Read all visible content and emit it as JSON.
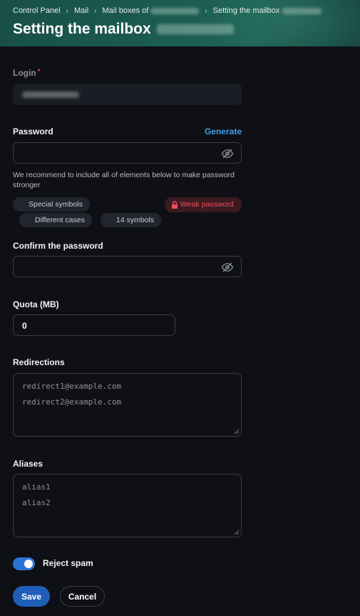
{
  "breadcrumb": {
    "items": [
      "Control Panel",
      "Mail",
      "Mail boxes of",
      "Setting the mailbox"
    ]
  },
  "page": {
    "title": "Setting the mailbox"
  },
  "form": {
    "login": {
      "label": "Login",
      "required_mark": "*"
    },
    "password": {
      "label": "Password",
      "generate_label": "Generate",
      "value": "",
      "hint": "We recommend to include all of elements below to make password stronger",
      "requirements": [
        "Special symbols",
        "Different cases",
        "14 symbols"
      ],
      "strength": "Weak password"
    },
    "confirm": {
      "label": "Confirm the password",
      "value": ""
    },
    "quota": {
      "label": "Quota (MB)",
      "value": "0"
    },
    "redirections": {
      "label": "Redirections",
      "placeholder_lines": [
        "redirect1@example.com",
        "redirect2@example.com"
      ]
    },
    "aliases": {
      "label": "Aliases",
      "placeholder_lines": [
        "alias1",
        "alias2"
      ]
    },
    "reject_spam": {
      "label": "Reject spam",
      "enabled": true
    }
  },
  "actions": {
    "save_label": "Save",
    "cancel_label": "Cancel"
  },
  "icons": {
    "password_toggle": "eye-off-icon",
    "lock": "lock-icon",
    "breadcrumb_separator": "chevron-right-icon"
  },
  "colors": {
    "accent": "#3fa0ea",
    "primary_button": "#1f5fb8",
    "toggle_on": "#2a74d8",
    "danger": "#f0505c",
    "header_bg": "#1b5a50"
  }
}
